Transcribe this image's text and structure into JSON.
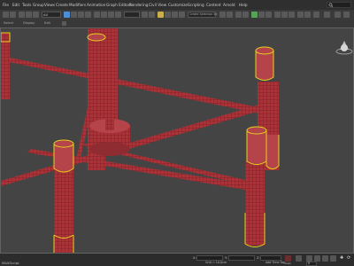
{
  "menu": {
    "items": [
      "File",
      "Edit",
      "Tools",
      "Group",
      "Views",
      "Create",
      "Modifiers",
      "Animation",
      "Graph Editors",
      "Rendering",
      "Civil View",
      "Customize",
      "Scripting",
      "Content",
      "Arnold",
      "Help"
    ],
    "search_icon": "search-icon"
  },
  "toolbar": {
    "selection_filter": "All",
    "named_selection": "Create Selection Se"
  },
  "ribbon": {
    "items": [
      "Select",
      "Display",
      "Edit"
    ]
  },
  "viewport": {
    "view_cube_icon": "viewcube-icon",
    "object_color": "#a8343a",
    "selection_color": "#e3d21a",
    "background_color": "#444444"
  },
  "status": {
    "left_label": "MAXScript",
    "coords": {
      "x": "X:",
      "y": "Y:",
      "z": "Z:"
    },
    "add_time_tag": "Add Time Tag",
    "grid": "Grid = 10,0cm",
    "auto_key": "Auto",
    "set_key": "Set Key",
    "selected": "Selected",
    "key_filters": "Key Filters...",
    "frame": "0"
  }
}
